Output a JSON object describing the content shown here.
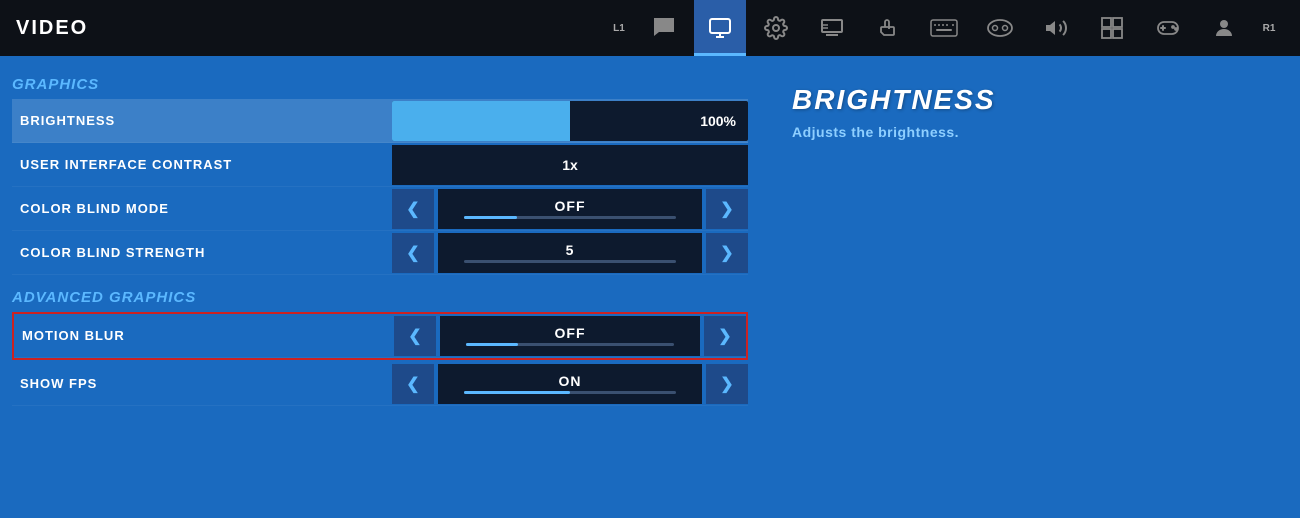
{
  "topbar": {
    "title": "VIDEO",
    "badge_left": "L1",
    "badge_right": "R1"
  },
  "nav_icons": [
    {
      "name": "chat-icon",
      "symbol": "💬",
      "active": false
    },
    {
      "name": "monitor-icon",
      "symbol": "🖥",
      "active": true
    },
    {
      "name": "gear-icon",
      "symbol": "⚙",
      "active": false
    },
    {
      "name": "display-icon",
      "symbol": "📺",
      "active": false
    },
    {
      "name": "touch-icon",
      "symbol": "☎",
      "active": false
    },
    {
      "name": "keyboard-icon",
      "symbol": "⌨",
      "active": false
    },
    {
      "name": "controller-icon",
      "symbol": "🎮",
      "active": false
    },
    {
      "name": "audio-icon",
      "symbol": "🔊",
      "active": false
    },
    {
      "name": "layout-icon",
      "symbol": "⊞",
      "active": false
    },
    {
      "name": "gamepad-icon",
      "symbol": "🕹",
      "active": false
    },
    {
      "name": "profile-icon",
      "symbol": "👤",
      "active": false
    }
  ],
  "graphics_section": {
    "header": "GRAPHICS",
    "settings": [
      {
        "id": "brightness",
        "label": "BRIGHTNESS",
        "type": "slider",
        "value": "100%",
        "fill_percent": 50,
        "active": true
      },
      {
        "id": "ui_contrast",
        "label": "USER INTERFACE CONTRAST",
        "type": "text_only",
        "value": "1x"
      },
      {
        "id": "color_blind_mode",
        "label": "COLOR BLIND MODE",
        "type": "toggle",
        "value": "OFF",
        "progress_fill": 25
      },
      {
        "id": "color_blind_strength",
        "label": "COLOR BLIND STRENGTH",
        "type": "toggle",
        "value": "5",
        "progress_fill": 0
      }
    ]
  },
  "advanced_graphics_section": {
    "header": "ADVANCED GRAPHICS",
    "settings": [
      {
        "id": "motion_blur",
        "label": "MOTION BLUR",
        "type": "toggle",
        "value": "OFF",
        "progress_fill": 25,
        "outlined": true
      },
      {
        "id": "show_fps",
        "label": "SHOW FPS",
        "type": "toggle",
        "value": "ON",
        "progress_fill": 50
      }
    ]
  },
  "detail_panel": {
    "title": "BRIGHTNESS",
    "description": "Adjusts the brightness."
  },
  "controls": {
    "arrow_left": "❮",
    "arrow_right": "❯"
  }
}
